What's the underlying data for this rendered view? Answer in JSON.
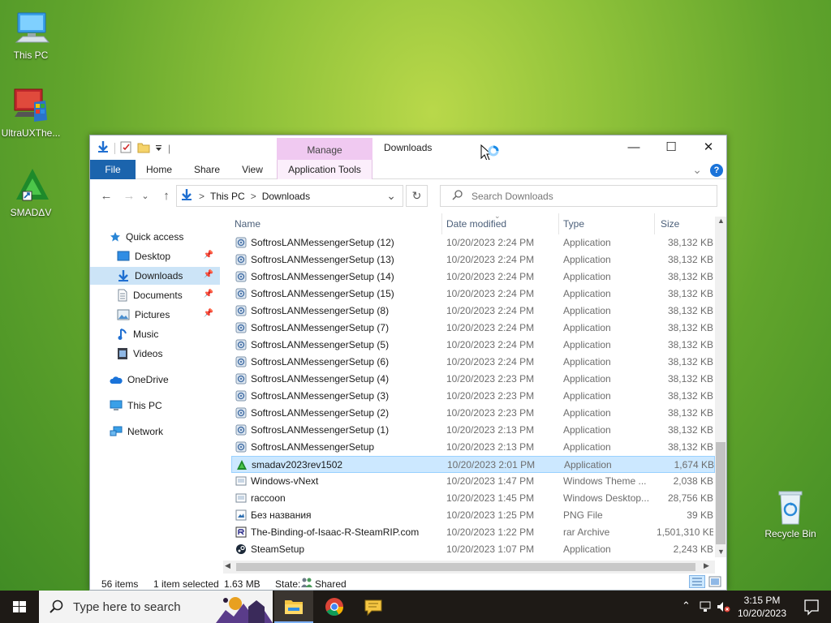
{
  "desktop": {
    "icons": [
      {
        "label": "This PC"
      },
      {
        "label": "UltraUXThe..."
      },
      {
        "label": "SMADΔV"
      },
      {
        "label": "Recycle Bin"
      }
    ]
  },
  "window": {
    "qat_sep": "|",
    "manage_label": "Manage",
    "title": "Downloads",
    "minimize": "—",
    "maximize": "☐",
    "close": "✕",
    "ribbon_tabs": {
      "file": "File",
      "home": "Home",
      "share": "Share",
      "view": "View",
      "app_tools": "Application Tools"
    },
    "ribbon_expand": "⌄",
    "help": "?"
  },
  "nav": {
    "back": "←",
    "forward": "→",
    "recent": "⌄",
    "up": "↑",
    "breadcrumb": [
      "This PC",
      "Downloads"
    ],
    "crumb_sep": ">",
    "address_dropdown": "⌄",
    "refresh": "↻",
    "search_placeholder": "Search Downloads"
  },
  "navpane": {
    "quick_access": "Quick access",
    "items": [
      {
        "label": "Desktop",
        "pinned": true
      },
      {
        "label": "Downloads",
        "pinned": true
      },
      {
        "label": "Documents",
        "pinned": true
      },
      {
        "label": "Pictures",
        "pinned": true
      },
      {
        "label": "Music"
      },
      {
        "label": "Videos"
      }
    ],
    "onedrive": "OneDrive",
    "this_pc": "This PC",
    "network": "Network"
  },
  "columns": {
    "name": "Name",
    "date": "Date modified",
    "type": "Type",
    "size": "Size"
  },
  "files": [
    {
      "name": "SoftrosLANMessengerSetup (12)",
      "date": "10/20/2023 2:24 PM",
      "type": "Application",
      "size": "38,132 KB",
      "icon": "installer"
    },
    {
      "name": "SoftrosLANMessengerSetup (13)",
      "date": "10/20/2023 2:24 PM",
      "type": "Application",
      "size": "38,132 KB",
      "icon": "installer"
    },
    {
      "name": "SoftrosLANMessengerSetup (14)",
      "date": "10/20/2023 2:24 PM",
      "type": "Application",
      "size": "38,132 KB",
      "icon": "installer"
    },
    {
      "name": "SoftrosLANMessengerSetup (15)",
      "date": "10/20/2023 2:24 PM",
      "type": "Application",
      "size": "38,132 KB",
      "icon": "installer"
    },
    {
      "name": "SoftrosLANMessengerSetup (8)",
      "date": "10/20/2023 2:24 PM",
      "type": "Application",
      "size": "38,132 KB",
      "icon": "installer"
    },
    {
      "name": "SoftrosLANMessengerSetup (7)",
      "date": "10/20/2023 2:24 PM",
      "type": "Application",
      "size": "38,132 KB",
      "icon": "installer"
    },
    {
      "name": "SoftrosLANMessengerSetup (5)",
      "date": "10/20/2023 2:24 PM",
      "type": "Application",
      "size": "38,132 KB",
      "icon": "installer"
    },
    {
      "name": "SoftrosLANMessengerSetup (6)",
      "date": "10/20/2023 2:24 PM",
      "type": "Application",
      "size": "38,132 KB",
      "icon": "installer"
    },
    {
      "name": "SoftrosLANMessengerSetup (4)",
      "date": "10/20/2023 2:23 PM",
      "type": "Application",
      "size": "38,132 KB",
      "icon": "installer"
    },
    {
      "name": "SoftrosLANMessengerSetup (3)",
      "date": "10/20/2023 2:23 PM",
      "type": "Application",
      "size": "38,132 KB",
      "icon": "installer"
    },
    {
      "name": "SoftrosLANMessengerSetup (2)",
      "date": "10/20/2023 2:23 PM",
      "type": "Application",
      "size": "38,132 KB",
      "icon": "installer"
    },
    {
      "name": "SoftrosLANMessengerSetup (1)",
      "date": "10/20/2023 2:13 PM",
      "type": "Application",
      "size": "38,132 KB",
      "icon": "installer"
    },
    {
      "name": "SoftrosLANMessengerSetup",
      "date": "10/20/2023 2:13 PM",
      "type": "Application",
      "size": "38,132 KB",
      "icon": "installer"
    },
    {
      "name": "smadav2023rev1502",
      "date": "10/20/2023 2:01 PM",
      "type": "Application",
      "size": "1,674 KB",
      "icon": "smadav",
      "selected": true
    },
    {
      "name": "Windows-vNext",
      "date": "10/20/2023 1:47 PM",
      "type": "Windows Theme ...",
      "size": "2,038 KB",
      "icon": "theme"
    },
    {
      "name": "raccoon",
      "date": "10/20/2023 1:45 PM",
      "type": "Windows Desktop...",
      "size": "28,756 KB",
      "icon": "theme"
    },
    {
      "name": "Без названия",
      "date": "10/20/2023 1:25 PM",
      "type": "PNG File",
      "size": "39 KB",
      "icon": "image"
    },
    {
      "name": "The-Binding-of-Isaac-R-SteamRIP.com",
      "date": "10/20/2023 1:22 PM",
      "type": "rar Archive",
      "size": "1,501,310 KB",
      "icon": "archive"
    },
    {
      "name": "SteamSetup",
      "date": "10/20/2023 1:07 PM",
      "type": "Application",
      "size": "2,243 KB",
      "icon": "steam"
    }
  ],
  "status": {
    "count": "56 items",
    "selected": "1 item selected",
    "size": "1.63 MB",
    "state_label": "State:",
    "state_value": "Shared"
  },
  "taskbar": {
    "search_placeholder": "Type here to search",
    "time": "3:15 PM",
    "date": "10/20/2023"
  },
  "colors": {
    "accent": "#1b64ad",
    "selection": "#cce8ff",
    "manage": "#f0c9f1"
  }
}
